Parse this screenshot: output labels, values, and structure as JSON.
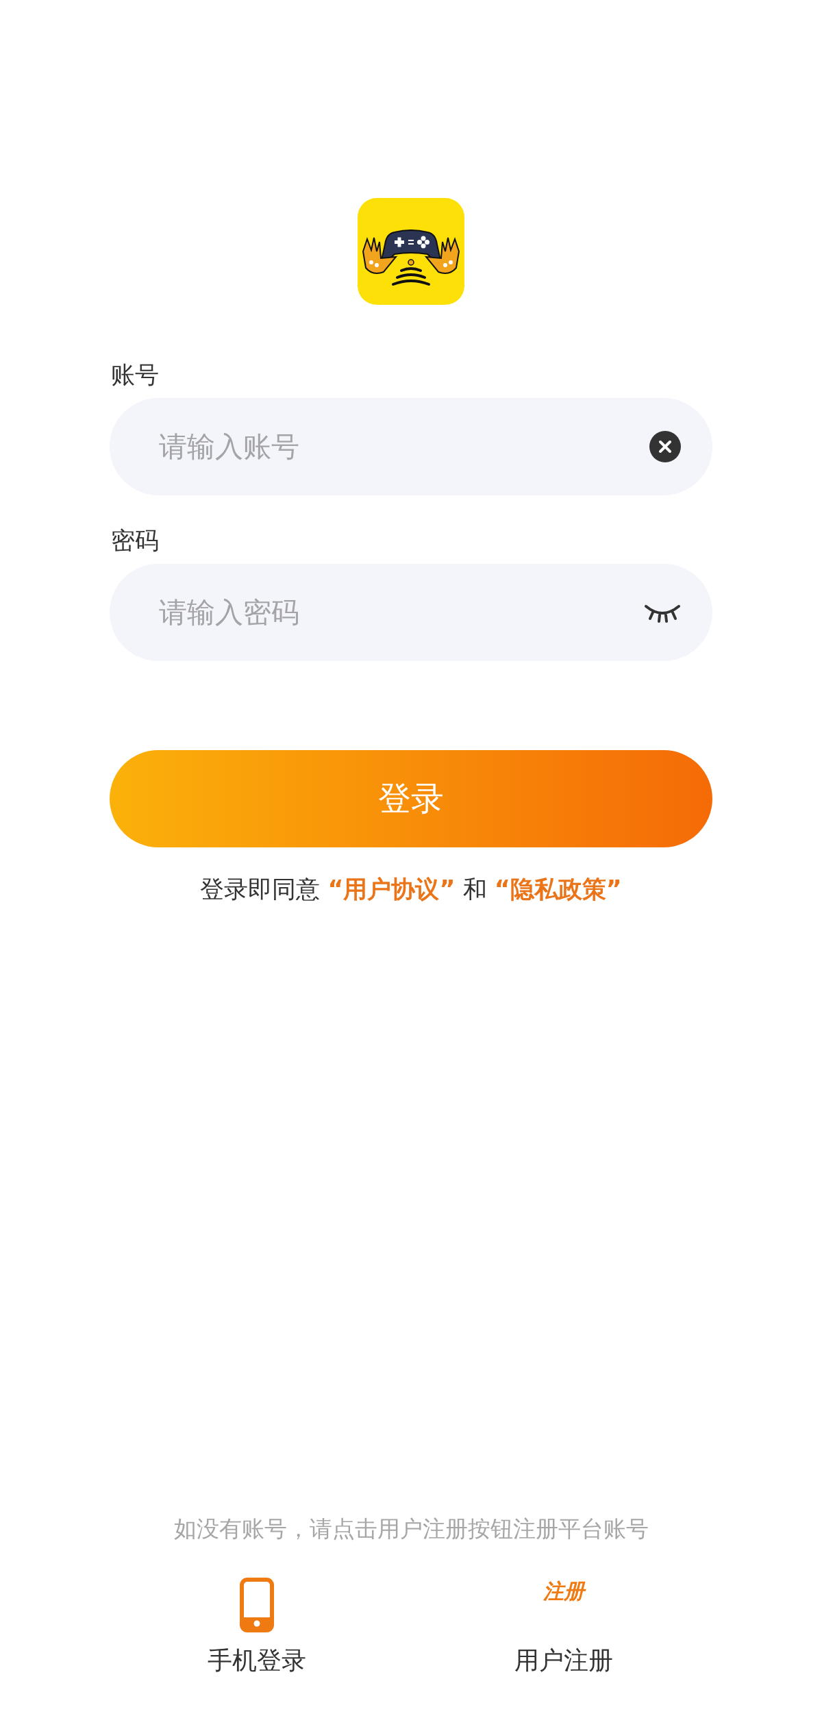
{
  "fields": [
    {
      "kind": "clear",
      "label": "账号",
      "placeholder": "请输入账号"
    },
    {
      "kind": "password",
      "label": "密码",
      "placeholder": "请输入密码"
    }
  ],
  "login_button": "登录",
  "agreement": [
    {
      "kind": "text",
      "text": "登录即同意 "
    },
    {
      "kind": "link",
      "text": "“用户协议”"
    },
    {
      "kind": "text",
      "text": " 和 "
    },
    {
      "kind": "link",
      "text": "“隐私政策”"
    }
  ],
  "hint": "如没有账号，请点击用户注册按钮注册平台账号",
  "bottom_options": [
    {
      "kind": "phone",
      "label": "手机登录"
    },
    {
      "kind": "register",
      "icon_text": "注册",
      "label": "用户注册"
    }
  ]
}
